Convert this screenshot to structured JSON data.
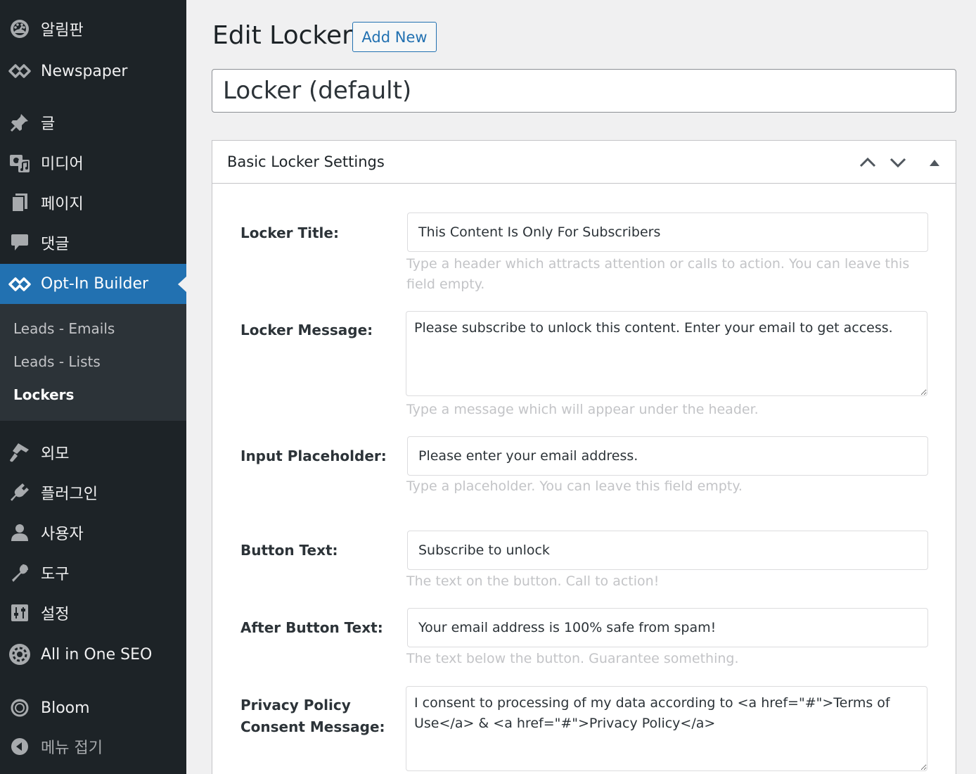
{
  "sidebar": {
    "items": [
      {
        "key": "dashboard",
        "label": "알림판",
        "icon": "dashboard-icon"
      },
      {
        "key": "newspaper",
        "label": "Newspaper",
        "icon": "newspaper-icon"
      },
      {
        "key": "posts",
        "label": "글",
        "icon": "pin-icon"
      },
      {
        "key": "media",
        "label": "미디어",
        "icon": "media-icon"
      },
      {
        "key": "pages",
        "label": "페이지",
        "icon": "page-icon"
      },
      {
        "key": "comments",
        "label": "댓글",
        "icon": "comment-icon"
      },
      {
        "key": "optin",
        "label": "Opt-In Builder",
        "icon": "optin-builder-icon"
      },
      {
        "key": "appearance",
        "label": "외모",
        "icon": "brush-icon"
      },
      {
        "key": "plugins",
        "label": "플러그인",
        "icon": "plugin-icon"
      },
      {
        "key": "users",
        "label": "사용자",
        "icon": "user-icon"
      },
      {
        "key": "tools",
        "label": "도구",
        "icon": "wrench-icon"
      },
      {
        "key": "settings",
        "label": "설정",
        "icon": "settings-icon"
      },
      {
        "key": "aioseo",
        "label": "All in One SEO",
        "icon": "aioseo-icon"
      },
      {
        "key": "bloom",
        "label": "Bloom",
        "icon": "bloom-icon"
      },
      {
        "key": "collapse",
        "label": "메뉴 접기",
        "icon": "collapse-icon"
      }
    ],
    "submenu": [
      {
        "label": "Leads - Emails"
      },
      {
        "label": "Leads - Lists"
      },
      {
        "label": "Lockers"
      }
    ],
    "colors": {
      "bg": "#1d2327",
      "active": "#2271b1",
      "submenu_bg": "#2c3338"
    }
  },
  "header": {
    "title": "Edit Locker",
    "add_new_label": "Add New"
  },
  "post_title": {
    "value": "Locker (default)"
  },
  "metabox": {
    "title": "Basic Locker Settings",
    "fields": {
      "locker_title": {
        "label": "Locker Title:",
        "value": "This Content Is Only For Subscribers",
        "help": "Type a header which attracts attention or calls to action. You can leave this field empty."
      },
      "locker_message": {
        "label": "Locker Message:",
        "value": "Please subscribe to unlock this content. Enter your email to get access.",
        "help": "Type a message which will appear under the header."
      },
      "input_placeholder": {
        "label": "Input Placeholder:",
        "value": "Please enter your email address.",
        "help": "Type a placeholder. You can leave this field empty."
      },
      "button_text": {
        "label": "Button Text:",
        "value": "Subscribe to unlock",
        "help": "The text on the button. Call to action!"
      },
      "after_button_text": {
        "label": "After Button Text:",
        "value": "Your email address is 100% safe from spam!",
        "help": "The text below the button. Guarantee something."
      },
      "privacy": {
        "label_line1": "Privacy Policy",
        "label_line2": "Consent Message:",
        "value": "I consent to processing of my data according to <a href=\"#\">Terms of Use</a> & <a href=\"#\">Privacy Policy</a>"
      }
    }
  }
}
